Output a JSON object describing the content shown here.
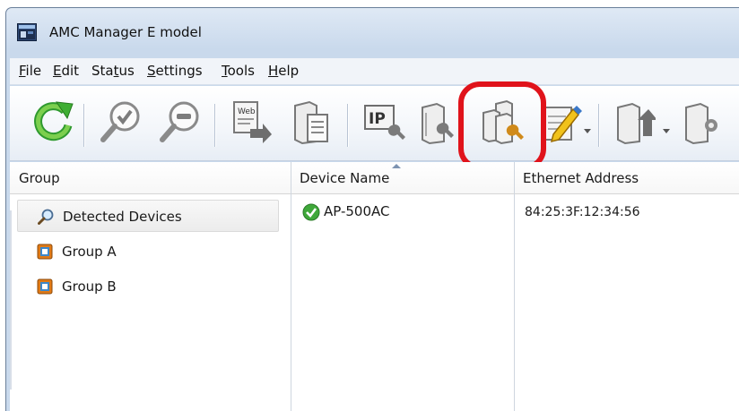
{
  "window": {
    "title": "AMC Manager E model"
  },
  "menu": [
    {
      "label": "File",
      "mnemonic": "F",
      "rest": "ile"
    },
    {
      "label": "Edit",
      "mnemonic": "E",
      "rest": "dit"
    },
    {
      "label": "Status",
      "pre": "Sta",
      "mnemonic": "t",
      "rest": "us"
    },
    {
      "label": "Settings",
      "mnemonic": "S",
      "rest": "ettings"
    },
    {
      "label": "Tools",
      "mnemonic": "T",
      "rest": "ools"
    },
    {
      "label": "Help",
      "mnemonic": "H",
      "rest": "elp"
    }
  ],
  "toolbar": {
    "icons": [
      "refresh-icon",
      "zoom-check-icon",
      "zoom-minus-icon",
      "web-export-icon",
      "device-document-icon",
      "ip-setting-icon",
      "device-wrench-icon",
      "multi-device-wrench-icon",
      "edit-pencil-icon",
      "device-upload-icon",
      "device-settings-icon"
    ],
    "web_label": "Web",
    "ip_label": "IP"
  },
  "highlight_color": "#e0131b",
  "group_panel": {
    "header": "Group",
    "items": [
      {
        "label": "Detected Devices",
        "icon": "search-icon",
        "selected": true
      },
      {
        "label": "Group A",
        "icon": "group-icon",
        "selected": false
      },
      {
        "label": "Group B",
        "icon": "group-icon",
        "selected": false
      }
    ]
  },
  "device_table": {
    "columns": [
      "Device Name",
      "Ethernet Address"
    ],
    "rows": [
      {
        "status_icon": "ok-check-icon",
        "device_name": "AP-500AC",
        "ethernet_address": "84:25:3F:12:34:56"
      }
    ]
  }
}
